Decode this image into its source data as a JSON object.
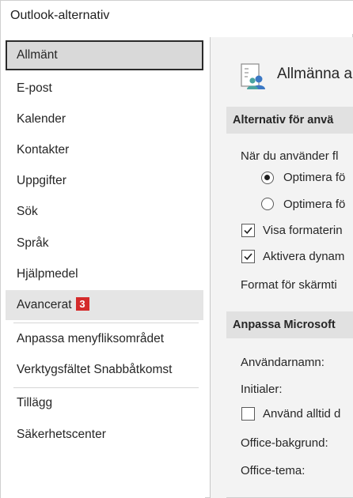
{
  "window": {
    "title": "Outlook-alternativ"
  },
  "sidebar": {
    "items": [
      {
        "label": "Allmänt"
      },
      {
        "label": "E-post"
      },
      {
        "label": "Kalender"
      },
      {
        "label": "Kontakter"
      },
      {
        "label": "Uppgifter"
      },
      {
        "label": "Sök"
      },
      {
        "label": "Språk"
      },
      {
        "label": "Hjälpmedel"
      },
      {
        "label": "Avancerat",
        "badge": "3"
      },
      {
        "label": "Anpassa menyfliksområdet"
      },
      {
        "label": "Verktygsfältet Snabbåtkomst"
      },
      {
        "label": "Tillägg"
      },
      {
        "label": "Säkerhetscenter"
      }
    ],
    "selected": "Allmänt",
    "hovered": "Avancerat"
  },
  "main": {
    "page_title": "Allmänna a",
    "page_icon": "general-options-icon",
    "sections": [
      {
        "header": "Alternativ för anvä",
        "lines": {
          "intro": "När du använder fl",
          "radio1": "Optimera fö",
          "radio2": "Optimera fö",
          "check1": "Visa formaterin",
          "check2": "Aktivera dynam",
          "screentip": "Format för skärmti"
        }
      },
      {
        "header": "Anpassa Microsoft",
        "lines": {
          "username": "Användarnamn:",
          "initials": "Initialer:",
          "always_use": "Använd alltid d",
          "background": "Office-bakgrund:",
          "theme": "Office-tema:"
        }
      }
    ],
    "states": {
      "radio1_selected": true,
      "radio2_selected": false,
      "check1_checked": true,
      "check2_checked": true,
      "always_use_checked": false
    }
  },
  "colors": {
    "selected_bg": "#d9d9d9",
    "selected_border": "#2b2b2b",
    "badge": "#d42a2a",
    "content_bg": "#f3f3f3",
    "section_header_bg": "#e1e1e1"
  }
}
